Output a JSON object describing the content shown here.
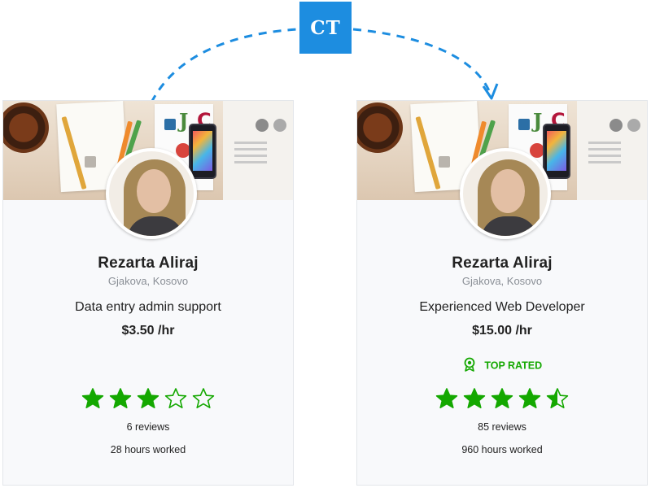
{
  "badge": {
    "label": "CT",
    "color": "#1d8de0"
  },
  "accent_color": "#14a800",
  "cards": [
    {
      "name": "Rezarta Aliraj",
      "location": "Gjakova, Kosovo",
      "title": "Data entry admin support",
      "rate": "$3.50 /hr",
      "top_rated": null,
      "rating": 3,
      "rating_max": 5,
      "reviews": "6 reviews",
      "hours": "28 hours worked"
    },
    {
      "name": "Rezarta Aliraj",
      "location": "Gjakova, Kosovo",
      "title": "Experienced Web Developer",
      "rate": "$15.00 /hr",
      "top_rated": {
        "label": "TOP RATED",
        "icon": "top-rated-badge-icon"
      },
      "rating": 4.5,
      "rating_max": 5,
      "reviews": "85 reviews",
      "hours": "960 hours worked"
    }
  ]
}
